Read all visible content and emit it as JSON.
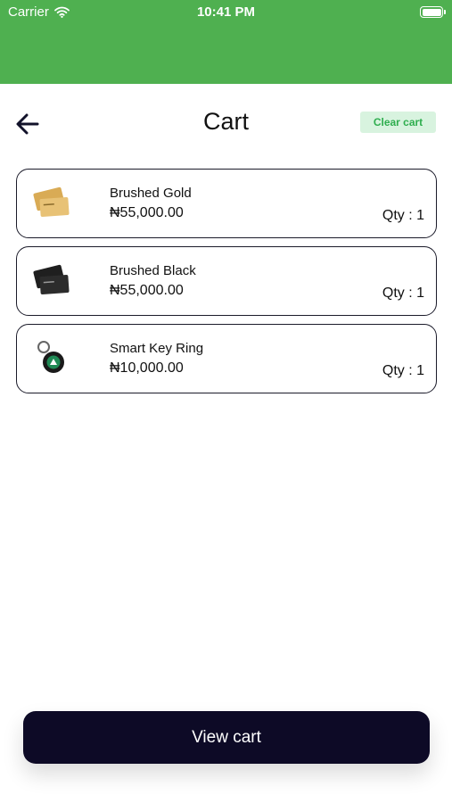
{
  "status_bar": {
    "carrier": "Carrier",
    "time": "10:41 PM",
    "icons": [
      "wifi-icon",
      "battery-icon"
    ]
  },
  "header": {
    "title": "Cart",
    "clear_label": "Clear cart",
    "back_icon": "arrow-left-icon"
  },
  "cart": {
    "items": [
      {
        "name": "Brushed Gold",
        "price": "₦55,000.00",
        "qty": "Qty : 1",
        "icon": "gold-card-icon"
      },
      {
        "name": "Brushed Black",
        "price": "₦55,000.00",
        "qty": "Qty : 1",
        "icon": "black-card-icon"
      },
      {
        "name": "Smart Key Ring",
        "price": "₦10,000.00",
        "qty": "Qty : 1",
        "icon": "key-ring-icon"
      }
    ]
  },
  "footer": {
    "view_cart_label": "View cart"
  },
  "colors": {
    "header_green": "#4fb050",
    "clear_bg": "#d8f3df",
    "clear_text": "#2fae4f",
    "primary_dark": "#0d0a26"
  }
}
